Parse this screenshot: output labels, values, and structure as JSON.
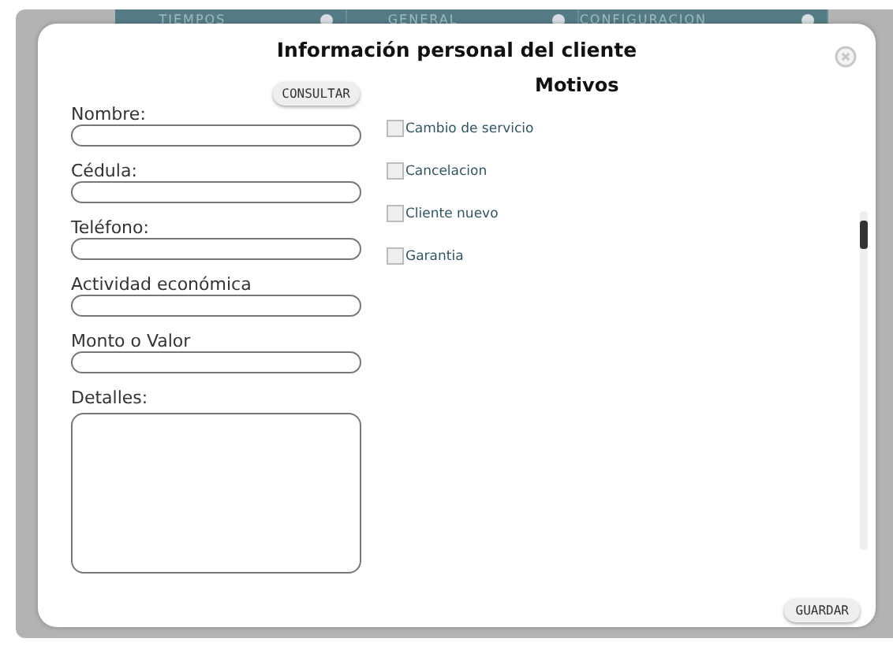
{
  "background_tabs": [
    {
      "label": "TIEMPOS"
    },
    {
      "label": "GENERAL"
    },
    {
      "label": "CONFIGURACION"
    }
  ],
  "dialog": {
    "title": "Información personal del cliente",
    "consult_button": "CONSULTAR",
    "fields": [
      {
        "label": "Nombre:",
        "kind": "input"
      },
      {
        "label": "Cédula:",
        "kind": "input"
      },
      {
        "label": "Teléfono:",
        "kind": "input"
      },
      {
        "label": "Actividad económica",
        "kind": "input"
      },
      {
        "label": "Monto o Valor",
        "kind": "input"
      },
      {
        "label": "Detalles:",
        "kind": "textarea"
      }
    ],
    "reasons": {
      "title": "Motivos",
      "items": [
        {
          "label": "Cambio de servicio",
          "checked": false
        },
        {
          "label": "Cancelacion",
          "checked": false
        },
        {
          "label": "Cliente nuevo",
          "checked": false
        },
        {
          "label": "Garantia",
          "checked": false
        }
      ]
    },
    "save_button": "GUARDAR"
  }
}
